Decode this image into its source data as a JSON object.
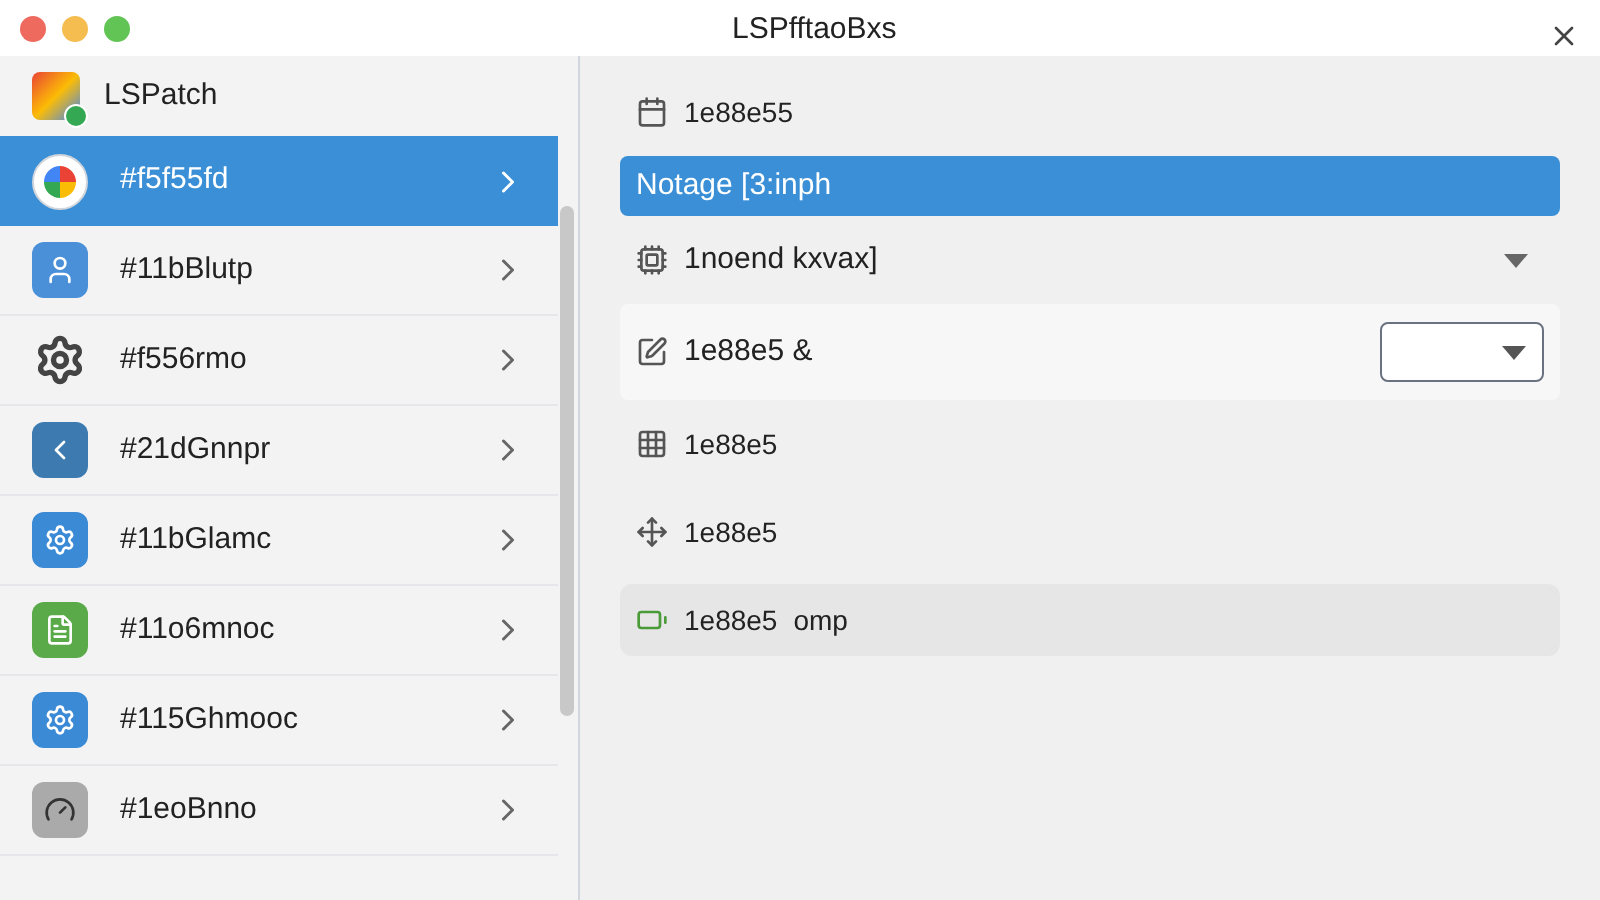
{
  "window": {
    "title": "LSPfftaoBxs"
  },
  "sidebar": {
    "header": "LSPatch",
    "items": [
      {
        "label": "#f5f55fd",
        "selected": true
      },
      {
        "label": "#11bBlutp",
        "selected": false
      },
      {
        "label": "#f556rmo",
        "selected": false
      },
      {
        "label": "#21dGnnpr",
        "selected": false
      },
      {
        "label": "#11bGlamc",
        "selected": false
      },
      {
        "label": "#11o6mnoc",
        "selected": false
      },
      {
        "label": "#115Ghmooc",
        "selected": false
      },
      {
        "label": "#1eoBnno",
        "selected": false
      }
    ]
  },
  "rows": [
    {
      "kind": "plain",
      "label": "1e88e55"
    },
    {
      "kind": "highlight",
      "label": "Notage [3:inph"
    },
    {
      "kind": "expander",
      "label": "1noend kxvax]",
      "expanded": false
    },
    {
      "kind": "dropdown",
      "label": "1e88e5 &"
    },
    {
      "kind": "plain",
      "label": "1e88e5"
    },
    {
      "kind": "plain",
      "label": "1e88e5"
    },
    {
      "kind": "extra",
      "label": "1e88e5",
      "extra": "omp"
    }
  ]
}
